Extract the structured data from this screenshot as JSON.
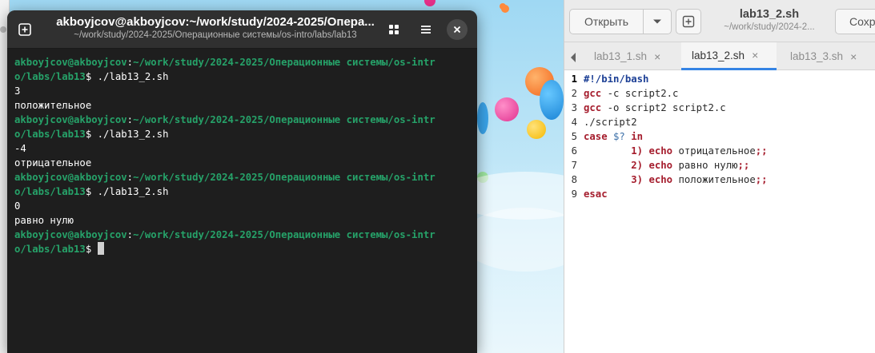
{
  "terminal": {
    "title": "akboyjcov@akboyjcov:~/work/study/2024-2025/Опера...",
    "subtitle": "~/work/study/2024-2025/Операционные системы/os-intro/labs/lab13",
    "lines": [
      {
        "type": "prompt",
        "user": "akboyjcov@akboyjcov",
        "path_a": "~/work/study/2024-2025/Операционные системы/os-intr",
        "path_b": "o/labs/lab13",
        "cmd": " ./lab13_2.sh"
      },
      {
        "type": "out",
        "text": "3"
      },
      {
        "type": "out",
        "text": "положительное"
      },
      {
        "type": "prompt",
        "user": "akboyjcov@akboyjcov",
        "path_a": "~/work/study/2024-2025/Операционные системы/os-intr",
        "path_b": "o/labs/lab13",
        "cmd": " ./lab13_2.sh"
      },
      {
        "type": "out",
        "text": "-4"
      },
      {
        "type": "out",
        "text": "отрицательное"
      },
      {
        "type": "prompt",
        "user": "akboyjcov@akboyjcov",
        "path_a": "~/work/study/2024-2025/Операционные системы/os-intr",
        "path_b": "o/labs/lab13",
        "cmd": " ./lab13_2.sh"
      },
      {
        "type": "out",
        "text": "0"
      },
      {
        "type": "out",
        "text": "равно нулю"
      },
      {
        "type": "prompt",
        "user": "akboyjcov@akboyjcov",
        "path_a": "~/work/study/2024-2025/Операционные системы/os-intr",
        "path_b": "o/labs/lab13",
        "cmd": " "
      }
    ],
    "prompt_sep": ":",
    "prompt_end": "$"
  },
  "editor": {
    "open_label": "Открыть",
    "title": "lab13_2.sh",
    "subtitle": "~/work/study/2024-2...",
    "save_label": "Сохр",
    "tabs": [
      {
        "label": "lab13_1.sh",
        "active": false
      },
      {
        "label": "lab13_2.sh",
        "active": true
      },
      {
        "label": "lab13_3.sh",
        "active": false
      }
    ],
    "tab_close": "×",
    "code": [
      {
        "n": "1",
        "parts": [
          {
            "c": "shebang",
            "t": "#!/bin/bash"
          }
        ]
      },
      {
        "n": "2",
        "parts": [
          {
            "c": "kw",
            "t": "gcc"
          },
          {
            "c": "ctext",
            "t": " -c script2.c"
          }
        ]
      },
      {
        "n": "3",
        "parts": [
          {
            "c": "kw",
            "t": "gcc"
          },
          {
            "c": "ctext",
            "t": " -o script2 script2.c"
          }
        ]
      },
      {
        "n": "4",
        "parts": [
          {
            "c": "ctext",
            "t": "./script2"
          }
        ]
      },
      {
        "n": "5",
        "parts": [
          {
            "c": "kw",
            "t": "case"
          },
          {
            "c": "ctext",
            "t": " "
          },
          {
            "c": "var",
            "t": "$?"
          },
          {
            "c": "ctext",
            "t": " "
          },
          {
            "c": "kw",
            "t": "in"
          }
        ]
      },
      {
        "n": "6",
        "parts": [
          {
            "c": "ctext",
            "t": "        "
          },
          {
            "c": "num",
            "t": "1)"
          },
          {
            "c": "ctext",
            "t": " "
          },
          {
            "c": "kw",
            "t": "echo"
          },
          {
            "c": "ctext",
            "t": " отрицательное"
          },
          {
            "c": "kw",
            "t": ";;"
          }
        ]
      },
      {
        "n": "7",
        "parts": [
          {
            "c": "ctext",
            "t": "        "
          },
          {
            "c": "num",
            "t": "2)"
          },
          {
            "c": "ctext",
            "t": " "
          },
          {
            "c": "kw",
            "t": "echo"
          },
          {
            "c": "ctext",
            "t": " равно нулю"
          },
          {
            "c": "kw",
            "t": ";;"
          }
        ]
      },
      {
        "n": "8",
        "parts": [
          {
            "c": "ctext",
            "t": "        "
          },
          {
            "c": "num",
            "t": "3)"
          },
          {
            "c": "ctext",
            "t": " "
          },
          {
            "c": "kw",
            "t": "echo"
          },
          {
            "c": "ctext",
            "t": " положительное"
          },
          {
            "c": "kw",
            "t": ";;"
          }
        ]
      },
      {
        "n": "9",
        "parts": [
          {
            "c": "kw",
            "t": "esac"
          }
        ]
      }
    ]
  },
  "colors": {
    "terminal_bg": "#1e1e1e",
    "prompt_green": "#26a269",
    "tab_accent": "#3584e4",
    "keyword_red": "#a51d2d"
  },
  "icons": {
    "terminal_new_tab": "plus-square-icon",
    "terminal_grid": "grid-icon",
    "terminal_menu": "hamburger-menu-icon",
    "terminal_close": "close-icon",
    "editor_dropdown": "chevron-down-icon",
    "editor_new_doc": "new-document-icon",
    "editor_tab_scroll": "chevron-left-icon"
  }
}
